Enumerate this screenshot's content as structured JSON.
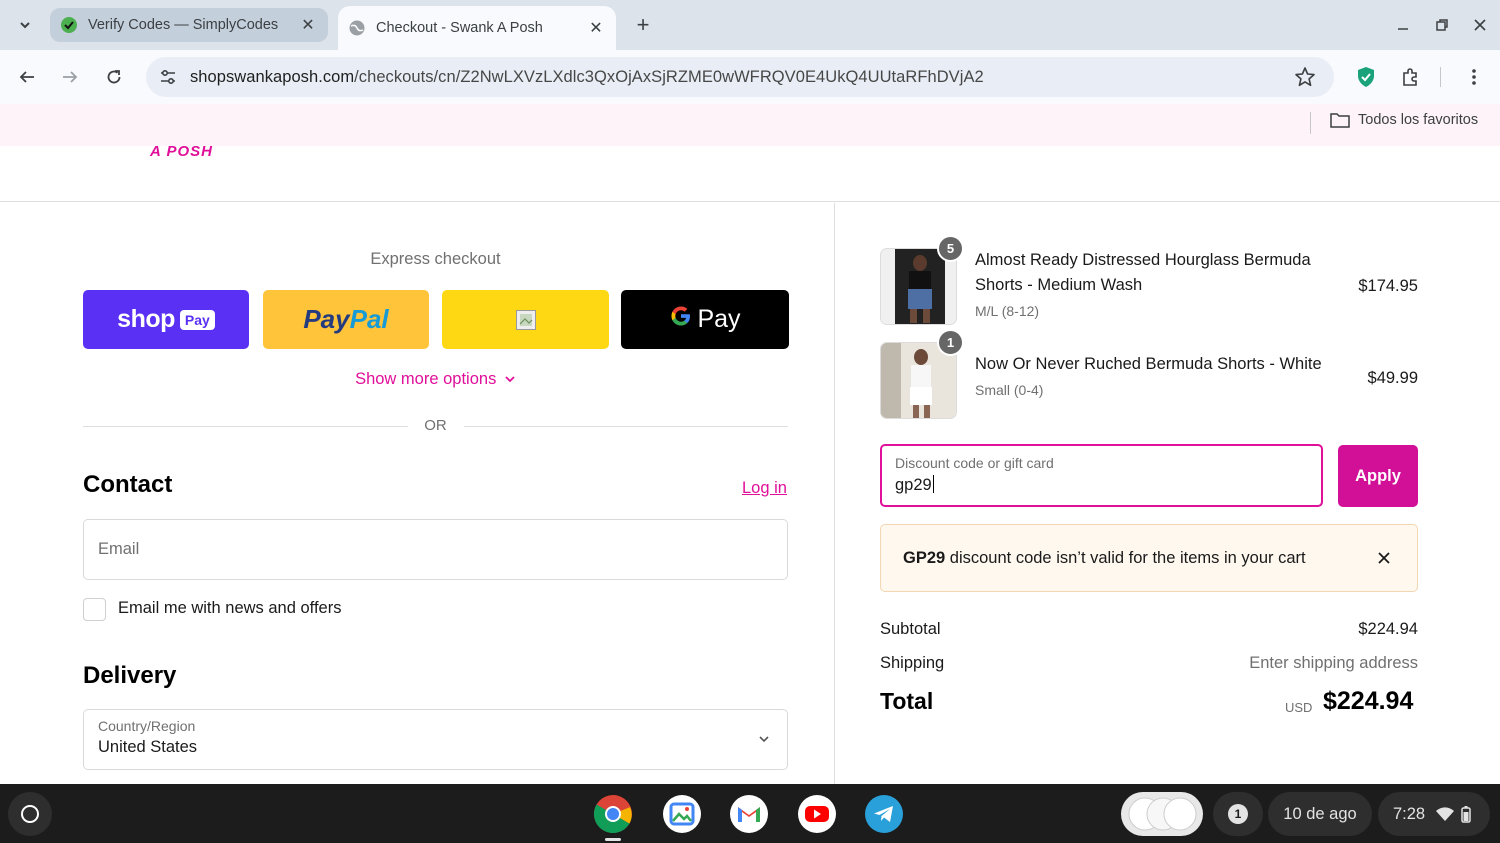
{
  "browser": {
    "tabs": [
      {
        "title": "Verify Codes — SimplyCodes",
        "active": false
      },
      {
        "title": "Checkout - Swank A Posh",
        "active": true
      }
    ],
    "url_domain": "shopswankaposh.com",
    "url_path": "/checkouts/cn/Z2NwLXVzLXdlc3QxOjAxSjRZME0wWFRQV0E4UkQ4UUtaRFhDVjA2",
    "bookmarks_all": "Todos los favoritos"
  },
  "store": {
    "logo_fragment": "A POSH"
  },
  "checkout": {
    "express_title": "Express checkout",
    "express_buttons": {
      "shoppay_word": "shop",
      "shoppay_badge": "Pay",
      "paypal_pay": "Pay",
      "paypal_pal": "Pal",
      "gpay_g": "G",
      "gpay_pay": "Pay"
    },
    "show_more": "Show more options",
    "or_text": "OR",
    "contact": {
      "heading": "Contact",
      "login": "Log in",
      "email_placeholder": "Email",
      "newsletter_label": "Email me with news and offers"
    },
    "delivery": {
      "heading": "Delivery",
      "country_label": "Country/Region",
      "country_value": "United States"
    }
  },
  "order_summary": {
    "items": [
      {
        "name": "Almost Ready Distressed Hourglass Bermuda Shorts - Medium Wash",
        "variant": "M/L (8-12)",
        "price": "$174.95",
        "quantity": "5"
      },
      {
        "name": "Now Or Never Ruched Bermuda Shorts - White",
        "variant": "Small (0-4)",
        "price": "$49.99",
        "quantity": "1"
      }
    ],
    "discount": {
      "label": "Discount code or gift card",
      "value": "gp29",
      "apply": "Apply"
    },
    "alert": {
      "code": "GP29",
      "message": " discount code isn’t valid for the items in your cart"
    },
    "subtotal_label": "Subtotal",
    "subtotal_value": "$224.94",
    "shipping_label": "Shipping",
    "shipping_value": "Enter shipping address",
    "total_label": "Total",
    "total_currency": "USD",
    "total_value": "$224.94"
  },
  "shelf": {
    "notification_count": "1",
    "date": "10 de ago",
    "time": "7:28"
  },
  "colors": {
    "accent_pink": "#e0109a",
    "apply_button": "#d11097",
    "shoppay_purple": "#5a31f4",
    "paypal_yellow": "#ffc439"
  }
}
